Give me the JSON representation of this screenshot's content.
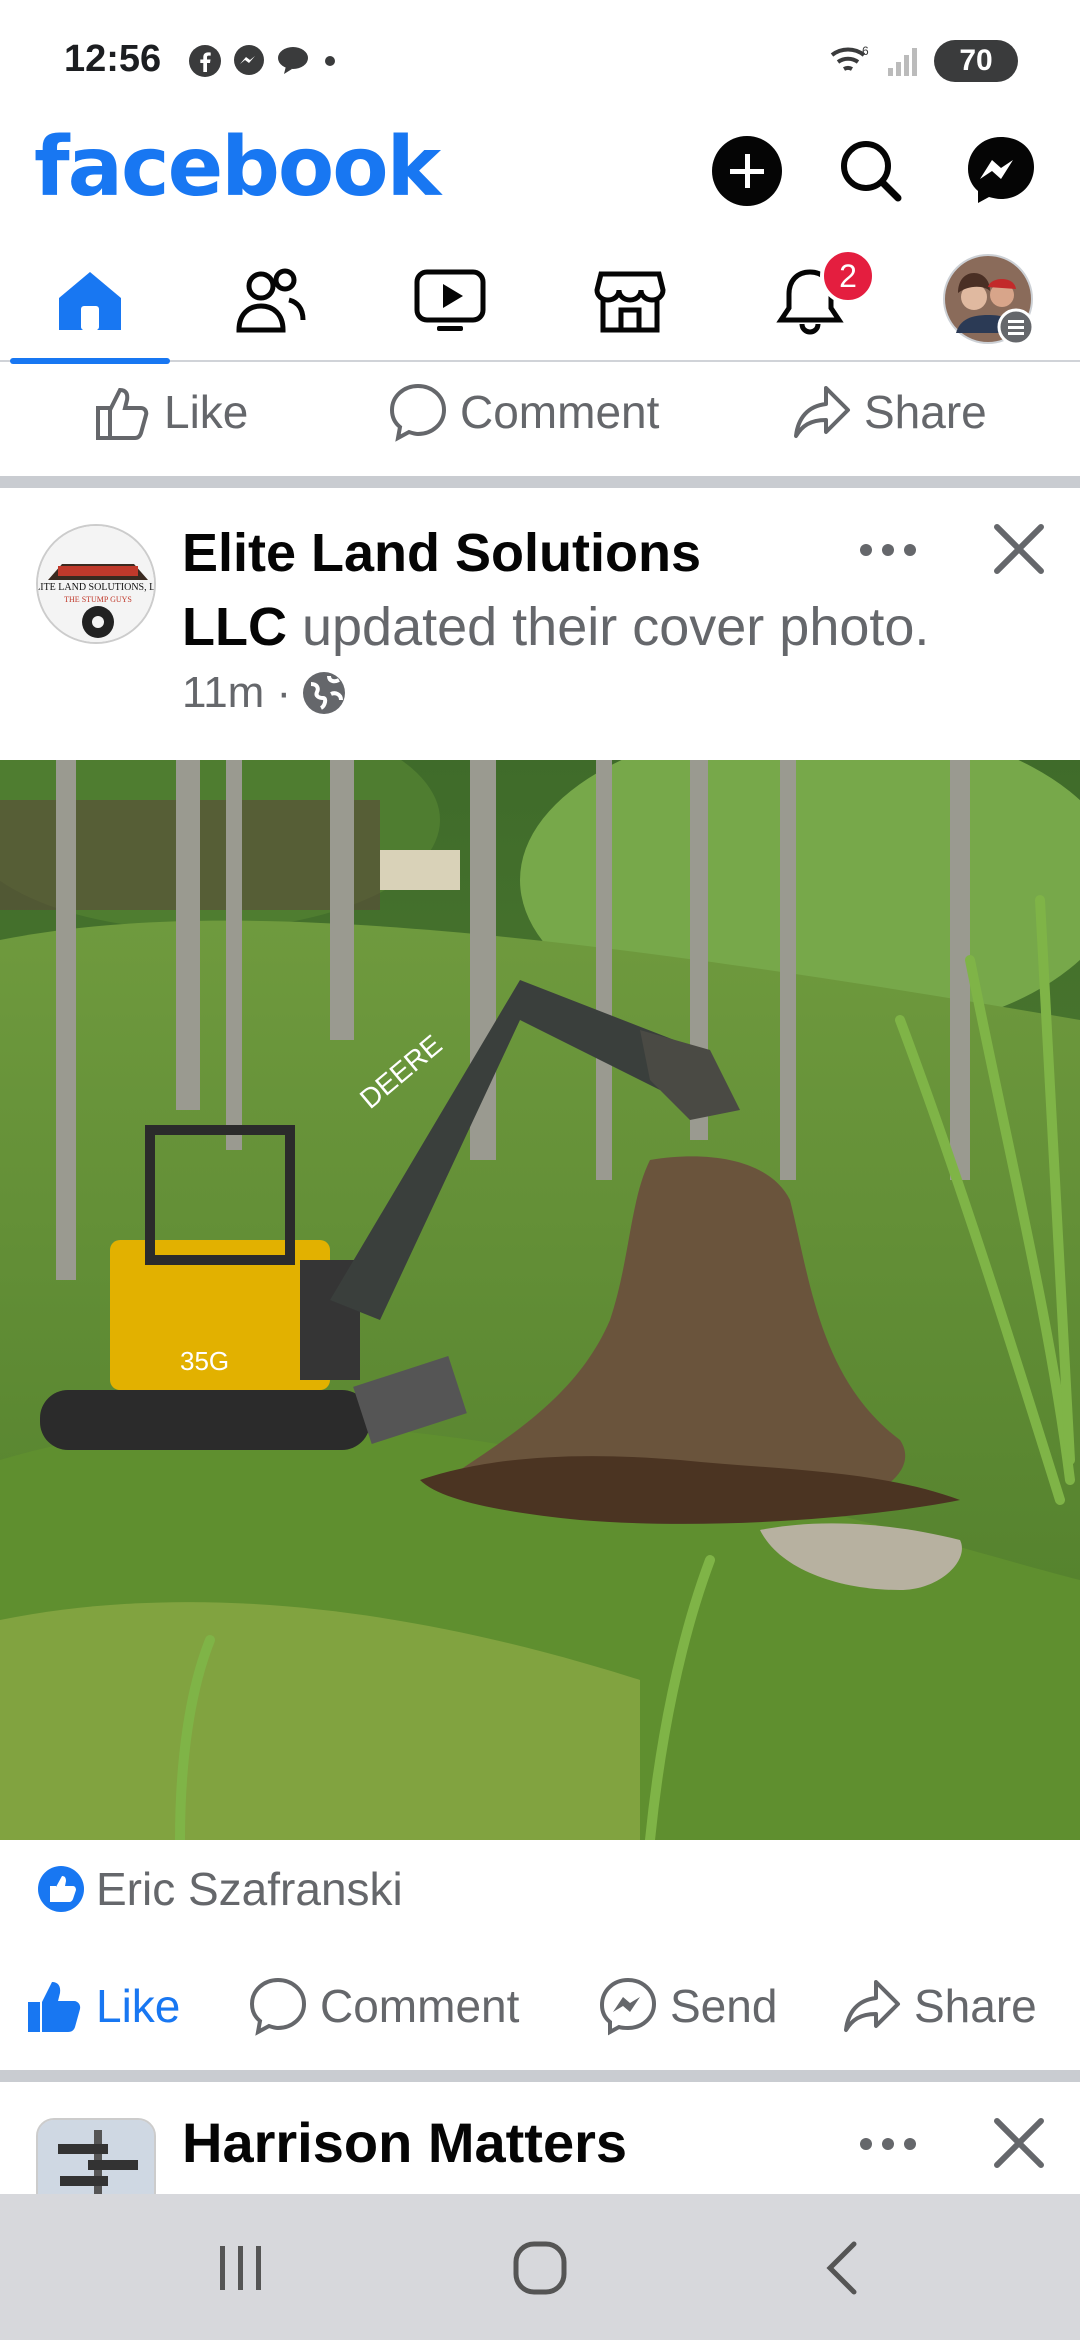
{
  "status_bar": {
    "time": "12:56",
    "battery": "70",
    "left_icons": [
      "facebook-icon",
      "messenger-icon",
      "chat-bubble-icon",
      "dot-icon"
    ],
    "right_icons": [
      "wifi-icon",
      "signal-icon",
      "battery-icon"
    ]
  },
  "header": {
    "logo": "facebook",
    "brand_color": "#1877f2"
  },
  "nav": {
    "items": [
      {
        "icon": "home-icon",
        "active": true
      },
      {
        "icon": "friends-icon",
        "active": false
      },
      {
        "icon": "video-icon",
        "active": false
      },
      {
        "icon": "marketplace-icon",
        "active": false
      },
      {
        "icon": "notifications-icon",
        "active": false,
        "badge": "2"
      },
      {
        "icon": "profile-menu-icon",
        "active": false
      }
    ]
  },
  "prev_post_actions": {
    "like": "Like",
    "comment": "Comment",
    "share": "Share"
  },
  "post": {
    "author_line1": "Elite Land Solutions",
    "author_line2": "LLC",
    "action_text": "updated their cover photo.",
    "time": "11m ·",
    "avatar_text": "ELITE LAND SOLUTIONS, LLC",
    "avatar_subtext": "THE STUMP GUYS",
    "reactor": "Eric Szafranski",
    "actions": {
      "like": "Like",
      "comment": "Comment",
      "send": "Send",
      "share": "Share"
    },
    "like_active_color": "#1877f2"
  },
  "next_post": {
    "author": "Harrison Matters"
  },
  "system_nav": [
    "recent-apps-icon",
    "home-circle-icon",
    "back-icon"
  ]
}
